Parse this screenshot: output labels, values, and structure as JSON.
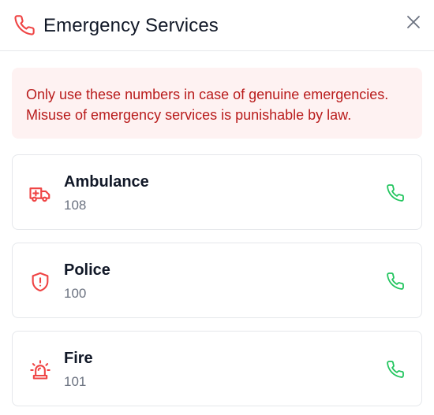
{
  "dialog": {
    "title": "Emergency Services",
    "header_icon": "phone-icon",
    "close_icon": "close-icon"
  },
  "warning": {
    "line1": "Only use these numbers in case of genuine emergencies.",
    "line2": "Misuse of emergency services is punishable by law."
  },
  "services": [
    {
      "name": "Ambulance",
      "number": "108",
      "icon": "ambulance-icon",
      "call_icon": "phone-icon"
    },
    {
      "name": "Police",
      "number": "100",
      "icon": "shield-alert-icon",
      "call_icon": "phone-icon"
    },
    {
      "name": "Fire",
      "number": "101",
      "icon": "siren-icon",
      "call_icon": "phone-icon"
    }
  ],
  "colors": {
    "accent_red": "#ef4444",
    "warning_bg": "#fef2f2",
    "warning_text": "#b91c1c",
    "call_green": "#22c55e"
  }
}
